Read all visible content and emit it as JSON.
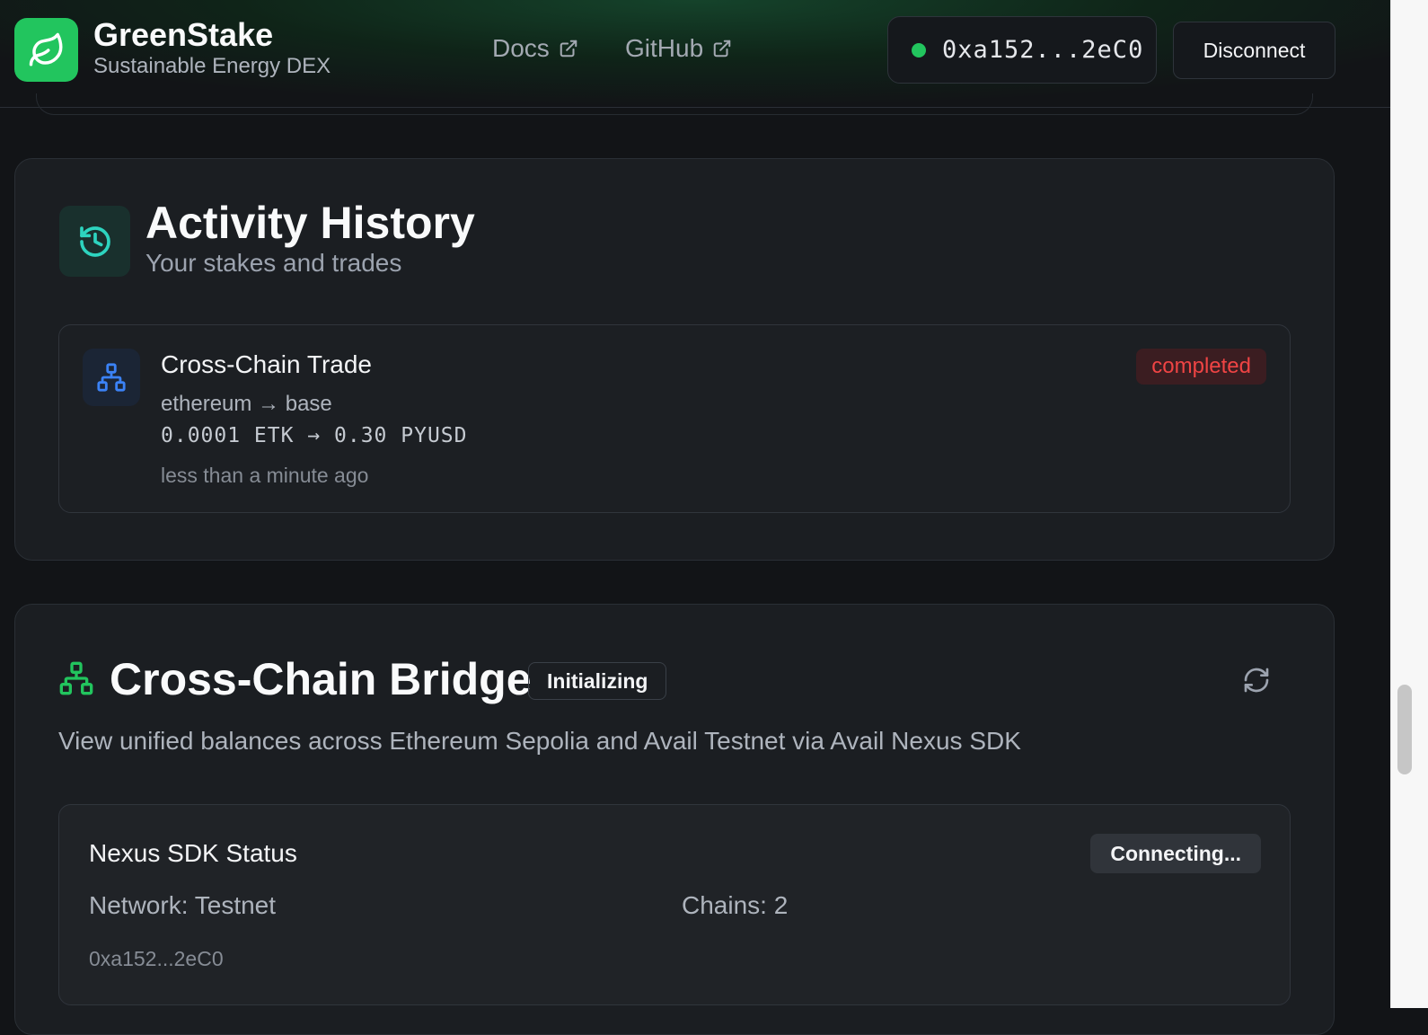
{
  "header": {
    "brand_title": "GreenStake",
    "brand_subtitle": "Sustainable Energy DEX",
    "logo_icon": "leaf-icon",
    "nav": [
      {
        "label": "Docs",
        "icon": "external-link-icon"
      },
      {
        "label": "GitHub",
        "icon": "external-link-icon"
      }
    ],
    "wallet_address": "0xa152...2eC0",
    "wallet_status_color": "#22c55e",
    "disconnect_label": "Disconnect"
  },
  "activity": {
    "title": "Activity History",
    "subtitle": "Your stakes and trades",
    "icon": "history-icon",
    "items": [
      {
        "title": "Cross-Chain Trade",
        "route": "ethereum → base",
        "amount": "0.0001 ETK → 0.30 PYUSD",
        "time": "less than a minute ago",
        "status": "completed",
        "icon": "network-icon"
      }
    ]
  },
  "bridge": {
    "title": "Cross-Chain Bridge",
    "badge": "Initializing",
    "description": "View unified balances across Ethereum Sepolia and Avail Testnet via Avail Nexus SDK",
    "icon": "network-icon",
    "refresh_icon": "refresh-icon",
    "status_panel": {
      "title": "Nexus SDK Status",
      "state": "Connecting...",
      "network": "Network: Testnet",
      "chains": "Chains: 2",
      "address": "0xa152...2eC0"
    }
  },
  "colors": {
    "accent": "#22c55e",
    "status_completed": "#ef4444",
    "background": "#121417",
    "card": "#1b1e22"
  }
}
